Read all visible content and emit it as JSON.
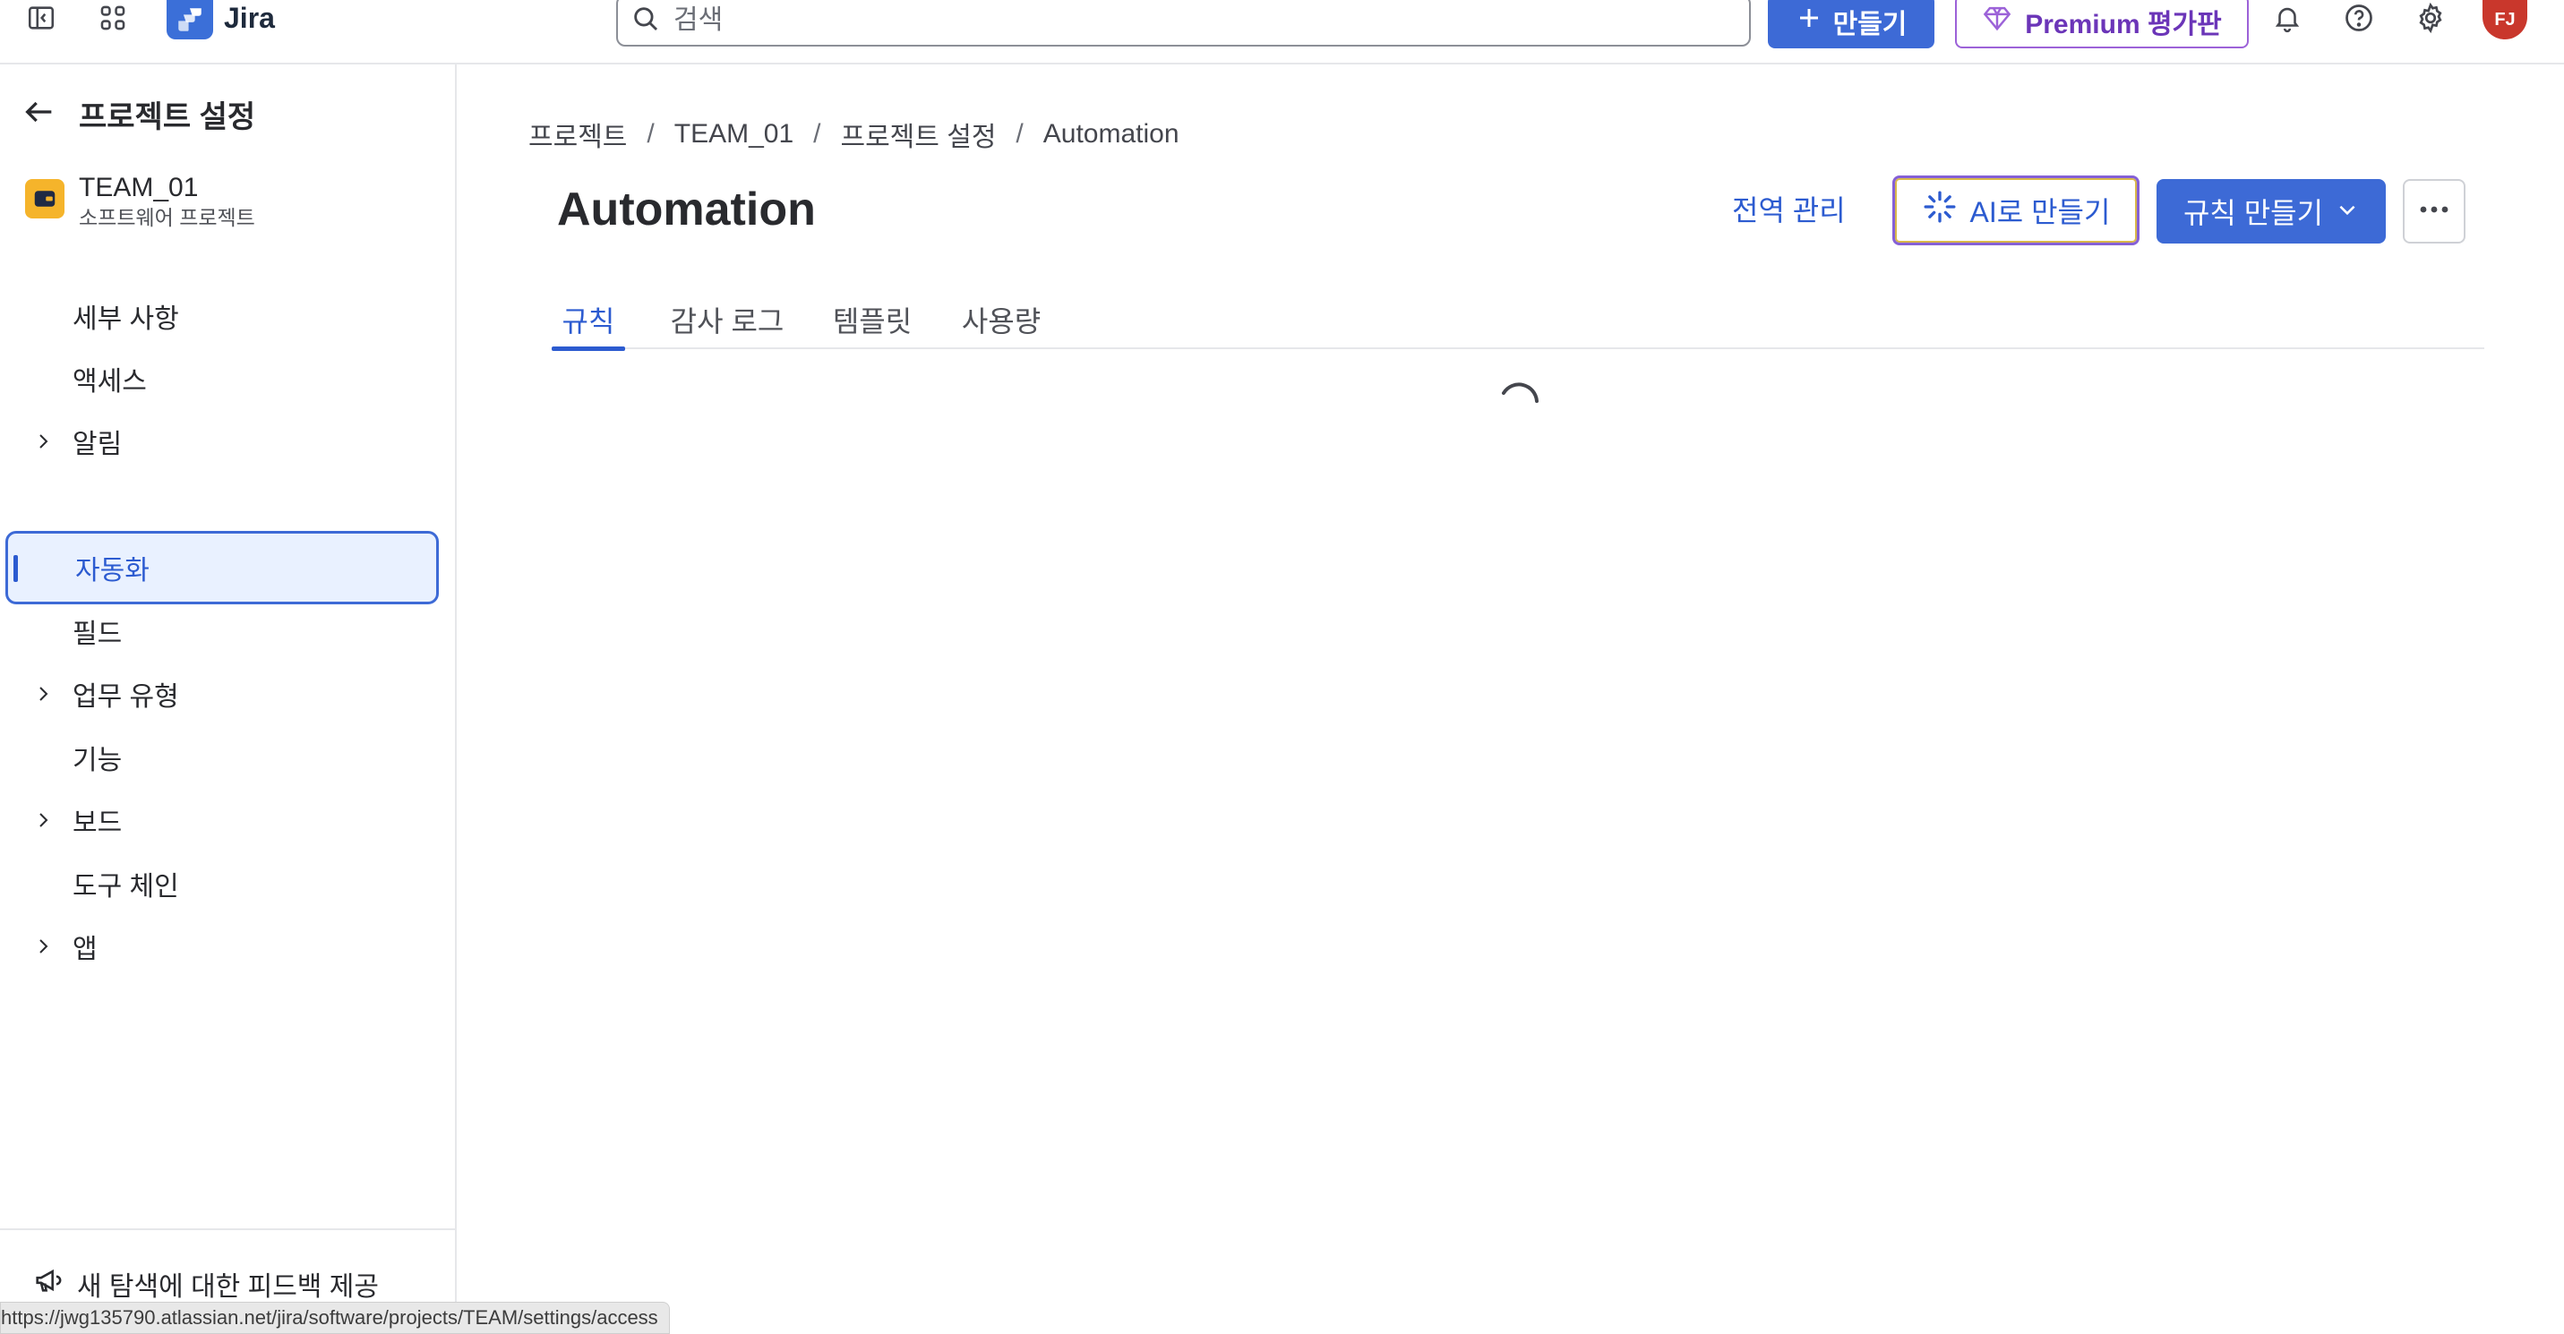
{
  "topbar": {
    "app_name": "Jira",
    "search_placeholder": "검색",
    "create_label": "만들기",
    "premium_label": "Premium 평가판",
    "avatar_initials": "FJ",
    "accent_color": "#3d6ad6",
    "premium_color": "#6b35b8",
    "avatar_color": "#c9372c"
  },
  "sidebar": {
    "back_title": "프로젝트 설정",
    "project": {
      "name": "TEAM_01",
      "type": "소프트웨어 프로젝트"
    },
    "items": [
      {
        "label": "세부 사항",
        "expandable": false,
        "selected": false
      },
      {
        "label": "액세스",
        "expandable": false,
        "selected": false
      },
      {
        "label": "알림",
        "expandable": true,
        "selected": false
      },
      {
        "label": "자동화",
        "expandable": false,
        "selected": true
      },
      {
        "label": "필드",
        "expandable": false,
        "selected": false
      },
      {
        "label": "업무 유형",
        "expandable": true,
        "selected": false
      },
      {
        "label": "기능",
        "expandable": false,
        "selected": false
      },
      {
        "label": "보드",
        "expandable": true,
        "selected": false
      },
      {
        "label": "도구 체인",
        "expandable": false,
        "selected": false
      },
      {
        "label": "앱",
        "expandable": true,
        "selected": false
      }
    ],
    "feedback_label": "새 탐색에 대한 피드백 제공"
  },
  "status_bar": {
    "url": "https://jwg135790.atlassian.net/jira/software/projects/TEAM/settings/access"
  },
  "main": {
    "breadcrumb": [
      "프로젝트",
      "TEAM_01",
      "프로젝트 설정",
      "Automation"
    ],
    "breadcrumb_separator": "/",
    "title": "Automation",
    "actions": {
      "global_manage": "전역 관리",
      "ai_create": "AI로 만들기",
      "create_rule": "규칙 만들기"
    },
    "tabs": [
      {
        "label": "규칙",
        "active": true
      },
      {
        "label": "감사 로그",
        "active": false
      },
      {
        "label": "템플릿",
        "active": false
      },
      {
        "label": "사용량",
        "active": false
      }
    ],
    "loading": true
  }
}
